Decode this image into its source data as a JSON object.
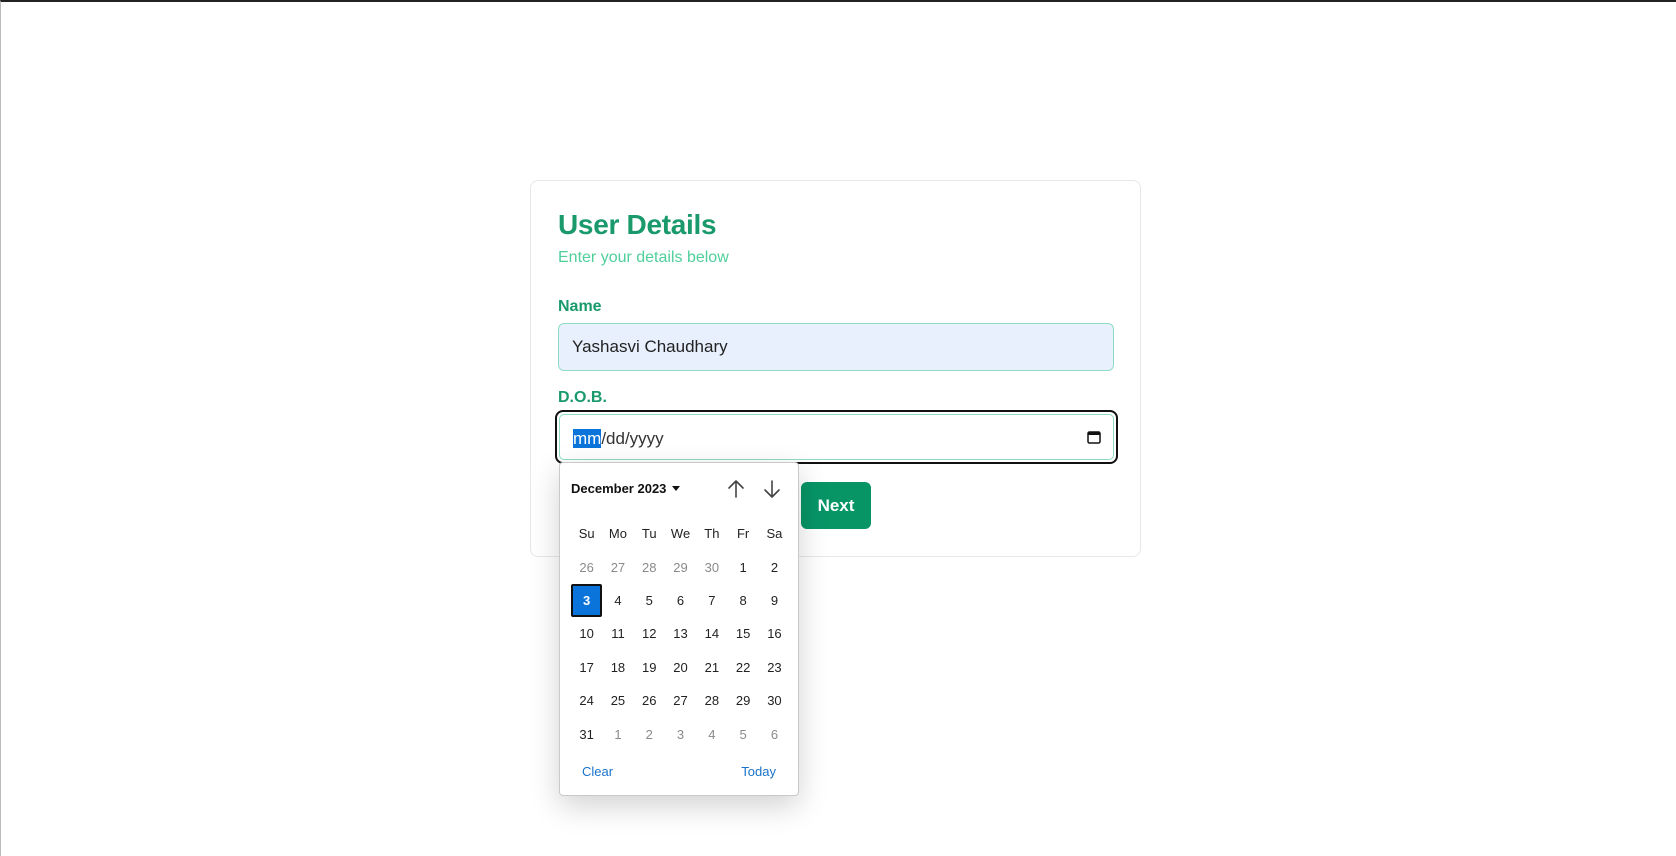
{
  "form": {
    "title": "User Details",
    "subtitle": "Enter your details below",
    "name_label": "Name",
    "name_value": "Yashasvi Chaudhary",
    "dob_label": "D.O.B.",
    "dob_mm": "mm",
    "dob_rest": "/dd/yyyy",
    "next_label": "Next"
  },
  "picker": {
    "month_label": "December 2023",
    "weekdays": [
      "Su",
      "Mo",
      "Tu",
      "We",
      "Th",
      "Fr",
      "Sa"
    ],
    "days": [
      {
        "d": "26",
        "muted": true
      },
      {
        "d": "27",
        "muted": true
      },
      {
        "d": "28",
        "muted": true
      },
      {
        "d": "29",
        "muted": true
      },
      {
        "d": "30",
        "muted": true
      },
      {
        "d": "1"
      },
      {
        "d": "2"
      },
      {
        "d": "3",
        "selected": true
      },
      {
        "d": "4"
      },
      {
        "d": "5"
      },
      {
        "d": "6"
      },
      {
        "d": "7"
      },
      {
        "d": "8"
      },
      {
        "d": "9"
      },
      {
        "d": "10"
      },
      {
        "d": "11"
      },
      {
        "d": "12"
      },
      {
        "d": "13"
      },
      {
        "d": "14"
      },
      {
        "d": "15"
      },
      {
        "d": "16"
      },
      {
        "d": "17"
      },
      {
        "d": "18"
      },
      {
        "d": "19"
      },
      {
        "d": "20"
      },
      {
        "d": "21"
      },
      {
        "d": "22"
      },
      {
        "d": "23"
      },
      {
        "d": "24"
      },
      {
        "d": "25"
      },
      {
        "d": "26"
      },
      {
        "d": "27"
      },
      {
        "d": "28"
      },
      {
        "d": "29"
      },
      {
        "d": "30"
      },
      {
        "d": "31"
      },
      {
        "d": "1",
        "muted": true
      },
      {
        "d": "2",
        "muted": true
      },
      {
        "d": "3",
        "muted": true
      },
      {
        "d": "4",
        "muted": true
      },
      {
        "d": "5",
        "muted": true
      },
      {
        "d": "6",
        "muted": true
      }
    ],
    "clear_label": "Clear",
    "today_label": "Today",
    "icons": {
      "prev": "arrow-up-icon",
      "next": "arrow-down-icon",
      "calendar": "calendar-icon"
    }
  },
  "colors": {
    "brand_green": "#1a9a6c",
    "subtitle_green": "#4fcf9b",
    "button_green": "#079566",
    "selection_blue": "#0a74da",
    "link_blue": "#1a73c8"
  }
}
